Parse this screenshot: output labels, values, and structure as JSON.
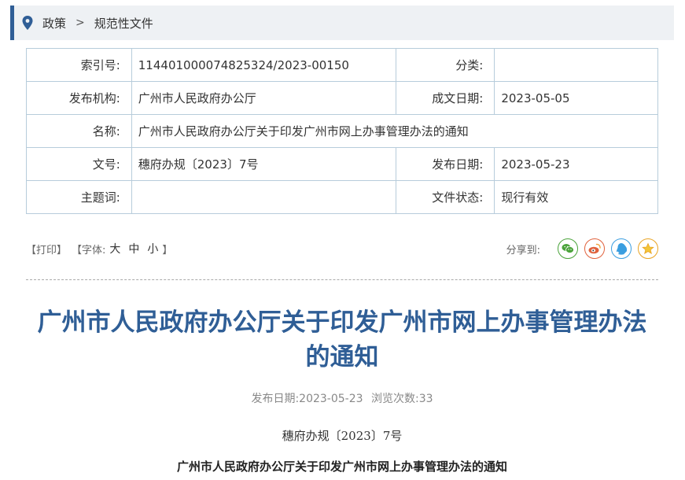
{
  "breadcrumb": {
    "items": [
      {
        "label": "政策"
      },
      {
        "label": "规范性文件"
      }
    ],
    "separator": ">"
  },
  "meta": {
    "rows": [
      {
        "l1": "索引号:",
        "v1": "114401000074825324/2023-00150",
        "l2": "分类:",
        "v2": ""
      },
      {
        "l1": "发布机构:",
        "v1": "广州市人民政府办公厅",
        "l2": "成文日期:",
        "v2": "2023-05-05"
      },
      {
        "l1": "名称:",
        "v1": "广州市人民政府办公厅关于印发广州市网上办事管理办法的通知"
      },
      {
        "l1": "文号:",
        "v1": "穗府办规〔2023〕7号",
        "l2": "发布日期:",
        "v2": "2023-05-23"
      },
      {
        "l1": "主题词:",
        "v1": "",
        "l2": "文件状态:",
        "v2": "现行有效"
      }
    ]
  },
  "toolbar": {
    "print_label": "【打印】",
    "font_prefix": "【字体:",
    "font_large": "大",
    "font_medium": "中",
    "font_small": "小",
    "font_suffix": "】",
    "share_label": "分享到:"
  },
  "colors": {
    "accent": "#2f5e96",
    "wechat": "#4aa33a",
    "weibo": "#e0623d",
    "qq": "#3a9ee0",
    "favorite": "#e9a423"
  },
  "article": {
    "title_line1": "广州市人民政府办公厅关于印发广州市网上办事管理办法",
    "title_line2": "的通知",
    "pub_date_label": "发布日期:",
    "pub_date": "2023-05-23",
    "views_label": "浏览次数:",
    "views": "33",
    "doc_number": "穗府办规〔2023〕7号",
    "doc_title": "广州市人民政府办公厅关于印发广州市网上办事管理办法的通知"
  }
}
